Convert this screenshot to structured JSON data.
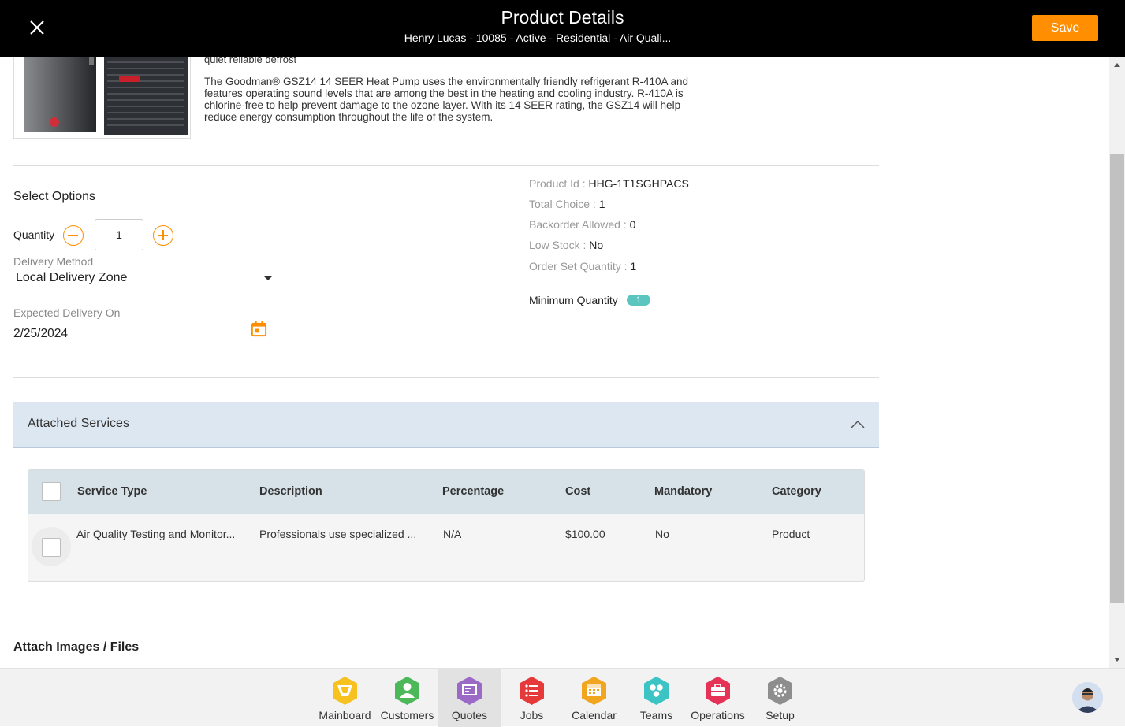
{
  "header": {
    "title": "Product Details",
    "subtitle": "Henry Lucas - 10085 - Active - Residential - Air Quali...",
    "save_label": "Save"
  },
  "product": {
    "desc_top": "quiet reliable defrost",
    "description": "The Goodman® GSZ14 14 SEER Heat Pump uses the environmentally friendly refrigerant R-410A and features operating sound levels that are among the best in the heating and cooling industry. R-410A is chlorine-free to help prevent damage to the ozone layer. With its 14 SEER rating, the GSZ14 will help reduce energy consumption throughout the life of the system."
  },
  "options": {
    "title": "Select Options",
    "quantity_label": "Quantity",
    "quantity_value": "1",
    "delivery_method_label": "Delivery Method",
    "delivery_method_value": "Local Delivery Zone",
    "expected_delivery_label": "Expected Delivery On",
    "expected_delivery_value": "2/25/2024"
  },
  "info": {
    "product_id_label": "Product Id : ",
    "product_id": "HHG-1T1SGHPACS",
    "total_choice_label": "Total Choice : ",
    "total_choice": "1",
    "backorder_label": "Backorder Allowed : ",
    "backorder": "0",
    "low_stock_label": "Low Stock : ",
    "low_stock": "No",
    "order_set_label": "Order Set Quantity : ",
    "order_set": "1",
    "min_qty_label": "Minimum Quantity",
    "min_qty": "1"
  },
  "attached_services": {
    "title": "Attached Services",
    "columns": [
      "Service Type",
      "Description",
      "Percentage",
      "Cost",
      "Mandatory",
      "Category"
    ],
    "rows": [
      {
        "service_type": "Air Quality Testing and Monitor...",
        "description": "Professionals use specialized ...",
        "percentage": "N/A",
        "cost": "$100.00",
        "mandatory": "No",
        "category": "Product"
      }
    ]
  },
  "attach_files": {
    "title": "Attach Images / Files"
  },
  "nav": {
    "items": [
      {
        "label": "Mainboard",
        "icon": "mainboard-icon",
        "color": "#f7c21f"
      },
      {
        "label": "Customers",
        "icon": "customers-icon",
        "color": "#4cb85a"
      },
      {
        "label": "Quotes",
        "icon": "quotes-icon",
        "color": "#9b6ac6"
      },
      {
        "label": "Jobs",
        "icon": "jobs-icon",
        "color": "#e63a3a"
      },
      {
        "label": "Calendar",
        "icon": "calendar-icon",
        "color": "#f2a51e"
      },
      {
        "label": "Teams",
        "icon": "teams-icon",
        "color": "#3cc4c4"
      },
      {
        "label": "Operations",
        "icon": "operations-icon",
        "color": "#e53357"
      },
      {
        "label": "Setup",
        "icon": "setup-icon",
        "color": "#8e8e8e"
      }
    ],
    "active": "Quotes"
  },
  "colors": {
    "accent": "#ff8f00",
    "header_bg": "#000000",
    "badge": "#5cc5c0"
  }
}
